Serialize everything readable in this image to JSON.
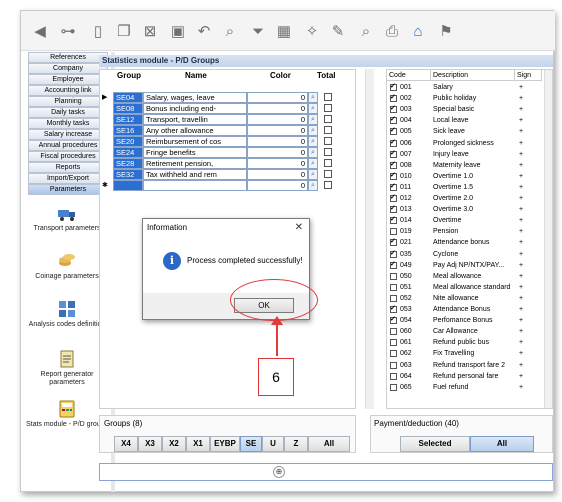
{
  "nav": [
    "References",
    "Company",
    "Employee",
    "Accounting link",
    "Planning",
    "Daily tasks",
    "Monthly tasks",
    "Salary increase",
    "Annual procedures",
    "Fiscal procedures",
    "Reports",
    "Import/Export",
    "Parameters"
  ],
  "nav_active": "Parameters",
  "side_items": [
    {
      "label": "Transport parameters",
      "icon": "truck-icon"
    },
    {
      "label": "Coinage parameters",
      "icon": "coins-icon"
    },
    {
      "label": "Analysis codes definition",
      "icon": "analysis-grid-icon"
    },
    {
      "label": "Report generator parameters",
      "icon": "report-icon"
    },
    {
      "label": "Stats module - P/D groups",
      "icon": "stats-calculator-icon"
    }
  ],
  "module_title": "Statistics module - P/D Groups",
  "grid": {
    "headers": {
      "group": "Group",
      "name": "Name",
      "color": "Color",
      "total": "Total"
    },
    "rows": [
      {
        "code": "SE04",
        "name": "Salary, wages, leave",
        "color": "0",
        "total": false
      },
      {
        "code": "SE08",
        "name": "Bonus including end-",
        "color": "0",
        "total": false
      },
      {
        "code": "SE12",
        "name": "Transport, travellin",
        "color": "0",
        "total": false
      },
      {
        "code": "SE16",
        "name": "Any other allowance",
        "color": "0",
        "total": false
      },
      {
        "code": "SE20",
        "name": "Reimbursement of cos",
        "color": "0",
        "total": false
      },
      {
        "code": "SE24",
        "name": "Fringe benefits",
        "color": "0",
        "total": false
      },
      {
        "code": "SE28",
        "name": "Retirement pension,",
        "color": "0",
        "total": false
      },
      {
        "code": "SE32",
        "name": "Tax withheld and rem",
        "color": "0",
        "total": false
      },
      {
        "code": "",
        "name": "",
        "color": "0",
        "total": false
      }
    ]
  },
  "codes": {
    "headers": {
      "code": "Code",
      "description": "Description",
      "sign": "Sign"
    },
    "rows": [
      {
        "checked": true,
        "code": "001",
        "desc": "Salary",
        "sign": "+"
      },
      {
        "checked": true,
        "code": "002",
        "desc": "Public holiday",
        "sign": "+"
      },
      {
        "checked": true,
        "code": "003",
        "desc": "Special basic",
        "sign": "+"
      },
      {
        "checked": true,
        "code": "004",
        "desc": "Local leave",
        "sign": "+"
      },
      {
        "checked": true,
        "code": "005",
        "desc": "Sick leave",
        "sign": "+"
      },
      {
        "checked": true,
        "code": "006",
        "desc": "Prolonged sickness",
        "sign": "+"
      },
      {
        "checked": true,
        "code": "007",
        "desc": "Injury leave",
        "sign": "+"
      },
      {
        "checked": true,
        "code": "008",
        "desc": "Maternity leave",
        "sign": "+"
      },
      {
        "checked": true,
        "code": "010",
        "desc": "Overtime 1.0",
        "sign": "+"
      },
      {
        "checked": true,
        "code": "011",
        "desc": "Overtime 1.5",
        "sign": "+"
      },
      {
        "checked": true,
        "code": "012",
        "desc": "Overtime 2.0",
        "sign": "+"
      },
      {
        "checked": true,
        "code": "013",
        "desc": "Overtime 3.0",
        "sign": "+"
      },
      {
        "checked": true,
        "code": "014",
        "desc": "Overtime",
        "sign": "+"
      },
      {
        "checked": false,
        "code": "019",
        "desc": "Pension",
        "sign": "+"
      },
      {
        "checked": true,
        "code": "021",
        "desc": "Attendance bonus",
        "sign": "+"
      },
      {
        "checked": true,
        "code": "035",
        "desc": "Cyclone",
        "sign": "+"
      },
      {
        "checked": true,
        "code": "049",
        "desc": "Pay Adj NP/NTX/PAY...",
        "sign": "+"
      },
      {
        "checked": false,
        "code": "050",
        "desc": "Meal allowance",
        "sign": "+"
      },
      {
        "checked": false,
        "code": "051",
        "desc": "Meal allowance standard",
        "sign": "+"
      },
      {
        "checked": false,
        "code": "052",
        "desc": "Nite allowance",
        "sign": "+"
      },
      {
        "checked": true,
        "code": "053",
        "desc": "Attendance Bonus",
        "sign": "+"
      },
      {
        "checked": true,
        "code": "054",
        "desc": "Perfomance Bonus",
        "sign": "+"
      },
      {
        "checked": false,
        "code": "060",
        "desc": "Car  Allowance",
        "sign": "+"
      },
      {
        "checked": false,
        "code": "061",
        "desc": "Refund public bus",
        "sign": "+"
      },
      {
        "checked": false,
        "code": "062",
        "desc": "Fix Travelling",
        "sign": "+"
      },
      {
        "checked": false,
        "code": "063",
        "desc": "Refund transport fare 2",
        "sign": "+"
      },
      {
        "checked": false,
        "code": "064",
        "desc": "Refund personal fare",
        "sign": "+"
      },
      {
        "checked": false,
        "code": "065",
        "desc": "Fuel refund",
        "sign": "+"
      }
    ]
  },
  "groups_box": {
    "label": "Groups (8)",
    "buttons": [
      "X4",
      "X3",
      "X2",
      "X1",
      "EYBP",
      "SE",
      "U",
      "Z",
      "All"
    ],
    "selected": "SE"
  },
  "pay_box": {
    "label": "Payment/deduction (40)",
    "buttons": [
      "Selected",
      "All"
    ],
    "selected": "All"
  },
  "dialog": {
    "title": "Information",
    "message": "Process completed successfully!",
    "ok": "OK",
    "close": "✕"
  },
  "annotation": {
    "number": "6",
    "color": "#e03b3b"
  },
  "colors": {
    "accent": "#2b6fd2",
    "title_bar": "#c4d4ea"
  }
}
